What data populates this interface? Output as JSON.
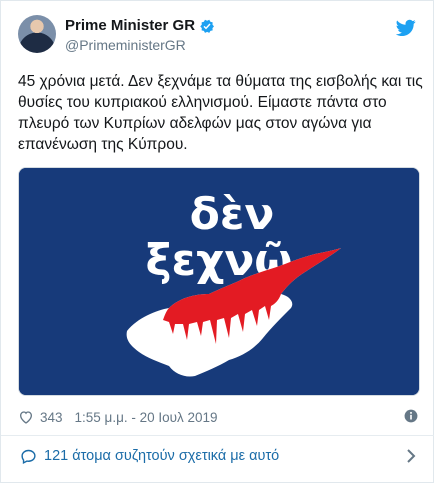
{
  "user": {
    "display_name": "Prime Minister GR",
    "handle": "@PrimeministerGR",
    "verified_icon": "verified-badge-icon",
    "brand_icon": "twitter-bird-icon"
  },
  "tweet": {
    "text": "45 χρόνια μετά. Δεν ξεχνάμε τα θύματα της εισβολής και τις θυσίες του κυπριακού ελληνισμού. Είμαστε πάντα στο πλευρό των Κυπρίων αδελφών μας στον αγώνα για επανένωση της Κύπρου."
  },
  "media": {
    "line1": "δὲν",
    "line2": "ξεχνῶ",
    "colors": {
      "background": "#173a7a",
      "island": "#ffffff",
      "blood": "#e31b23"
    }
  },
  "meta": {
    "likes": "343",
    "timestamp": "1:55 μ.μ. - 20 Ιουλ 2019"
  },
  "conversation": {
    "label": "121 άτομα συζητούν σχετικά με αυτό"
  },
  "colors": {
    "accent": "#1da1f2",
    "link": "#1b6ca8",
    "muted": "#657786"
  }
}
